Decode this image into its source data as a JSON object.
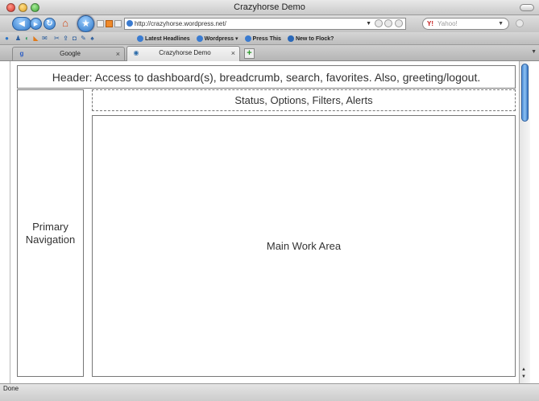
{
  "window": {
    "title": "Crazyhorse Demo"
  },
  "toolbar": {
    "back_glyph": "◀",
    "forward_glyph": "▶",
    "reload_glyph": "↻",
    "home_glyph": "⌂",
    "star_glyph": "★",
    "url": "http://crazyhorse.wordpress.net/",
    "url_dropdown": "▼",
    "search_placeholder": "Yahoo!",
    "search_logo": "Y!",
    "search_dropdown": "▼"
  },
  "bookmarks": {
    "links": [
      {
        "label": "Latest Headlines",
        "color": "#3a7bd0"
      },
      {
        "label": "Wordpress ▾",
        "color": "#3a7bd0"
      },
      {
        "label": "Press This",
        "color": "#3a7bd0"
      },
      {
        "label": "New to Flock?",
        "color": "#2a68b8"
      }
    ]
  },
  "tabs": [
    {
      "label": "Google",
      "favicon": "g",
      "close": "×"
    },
    {
      "label": "Crazyhorse Demo",
      "favicon": "◉",
      "close": "×"
    }
  ],
  "new_tab_glyph": "+",
  "tab_scroll_glyph": "▼",
  "wireframe": {
    "header": "Header: Access to dashboard(s), breadcrumb, search, favorites. Also, greeting/logout.",
    "nav_line1": "Primary",
    "nav_line2": "Navigation",
    "status": "Status, Options, Filters, Alerts",
    "main": "Main Work Area"
  },
  "statusbar": {
    "text": "Done"
  },
  "colors": {
    "accent": "#2a74c7",
    "home": "#d04a1a"
  }
}
